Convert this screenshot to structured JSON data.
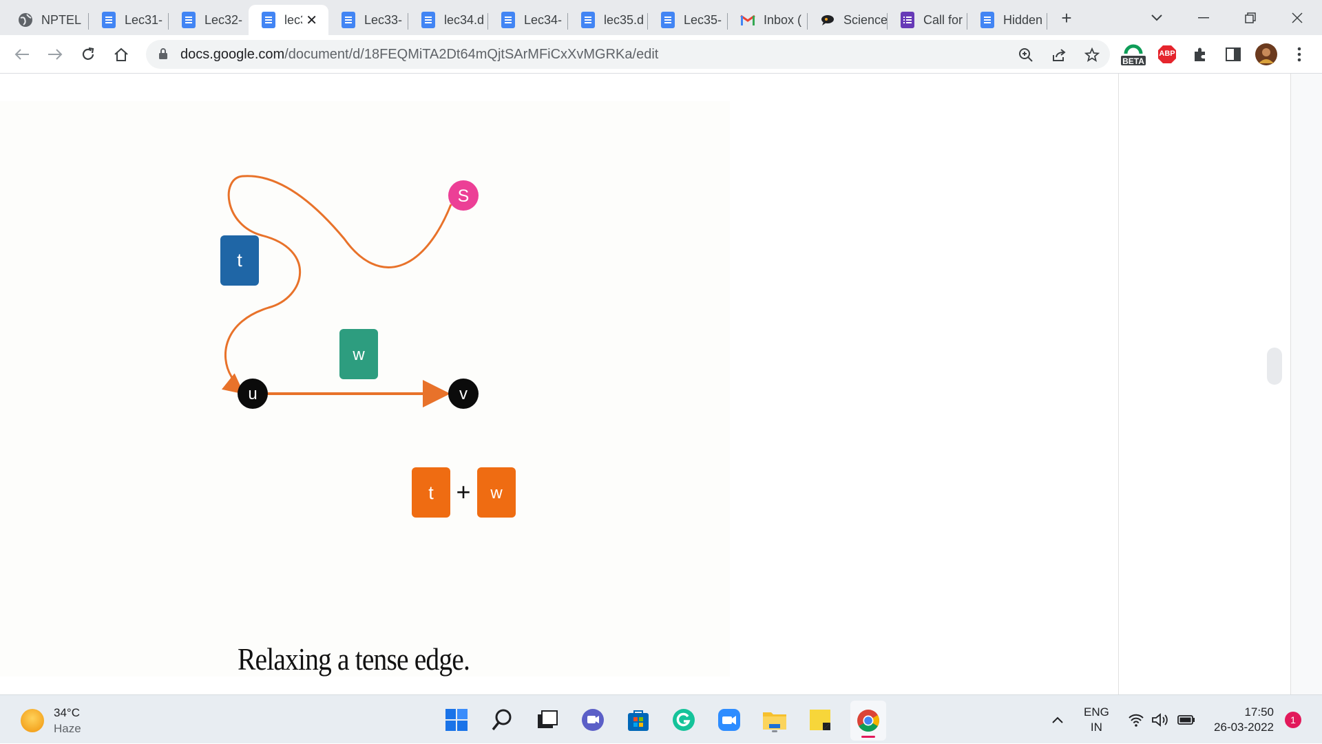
{
  "browser": {
    "tabs": [
      {
        "label": "NPTEL",
        "icon": "globe-icon",
        "active": false
      },
      {
        "label": "Lec31-",
        "icon": "google-docs-icon",
        "active": false
      },
      {
        "label": "Lec32-",
        "icon": "google-docs-icon",
        "active": false
      },
      {
        "label": "lec3",
        "icon": "google-docs-icon",
        "active": true
      },
      {
        "label": "Lec33-",
        "icon": "google-docs-icon",
        "active": false
      },
      {
        "label": "lec34.d",
        "icon": "google-docs-icon",
        "active": false
      },
      {
        "label": "Lec34-",
        "icon": "google-docs-icon",
        "active": false
      },
      {
        "label": "lec35.d",
        "icon": "google-docs-icon",
        "active": false
      },
      {
        "label": "Lec35-",
        "icon": "google-docs-icon",
        "active": false
      },
      {
        "label": "Inbox (",
        "icon": "gmail-icon",
        "active": false
      },
      {
        "label": "Science",
        "icon": "chat-bubble-icon",
        "active": false
      },
      {
        "label": "Call for",
        "icon": "google-forms-icon",
        "active": false
      },
      {
        "label": "Hidden",
        "icon": "google-docs-icon",
        "active": false
      }
    ],
    "new_tab_label": "+",
    "url_host": "docs.google.com",
    "url_path": "/document/d/18FEQMiTA2Dt64mQjtSArMFiCxXvMGRKa/edit",
    "extension_badge": "BETA",
    "abp_label": "ABP"
  },
  "figure": {
    "nodes": {
      "s": "S",
      "u": "u",
      "v": "v"
    },
    "weights": {
      "t": "t",
      "w": "w",
      "sum_left": "t",
      "plus": "+",
      "sum_right": "w"
    },
    "caption": "Relaxing a tense edge."
  },
  "colors": {
    "edge": "#e8722a",
    "node_s": "#ec3f96",
    "node_uv": "#0b0b0b",
    "weight_t": "#1f66a6",
    "weight_w": "#2d9d7f",
    "weight_sum": "#ef6c12"
  },
  "taskbar": {
    "temperature": "34°C",
    "condition": "Haze",
    "language_top": "ENG",
    "language_bottom": "IN",
    "time": "17:50",
    "date": "26-03-2022",
    "notification_count": "1"
  }
}
